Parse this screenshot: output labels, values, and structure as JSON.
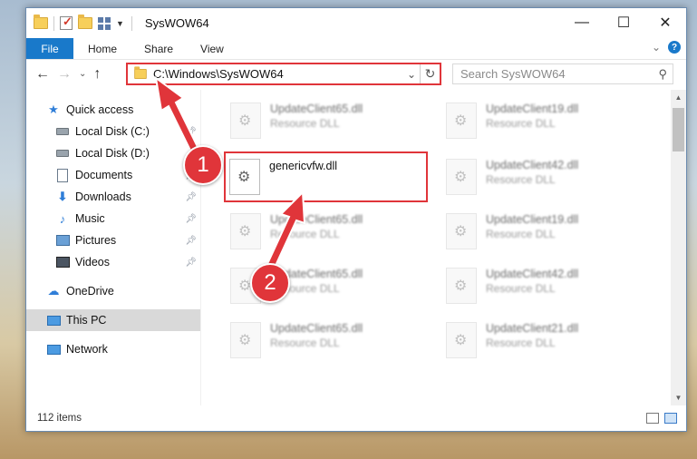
{
  "window": {
    "title": "SysWOW64",
    "controls": {
      "minimize": "—",
      "maximize": "☐",
      "close": "✕"
    }
  },
  "ribbon": {
    "file_tab": "File",
    "tabs": [
      "Home",
      "Share",
      "View"
    ],
    "expand_glyph": "⌄",
    "help_glyph": "?"
  },
  "navigation": {
    "back": "←",
    "forward": "→",
    "recent": "⌄",
    "up": "↑"
  },
  "address": {
    "path": "C:\\Windows\\SysWOW64",
    "dropdown": "⌄",
    "refresh": "↻"
  },
  "search": {
    "placeholder": "Search SysWOW64",
    "icon": "search-icon"
  },
  "sidebar": {
    "items": [
      {
        "label": "Quick access",
        "icon": "star-icon",
        "pinned": false
      },
      {
        "label": "Local Disk (C:)",
        "icon": "drive-icon",
        "pinned": true
      },
      {
        "label": "Local Disk (D:)",
        "icon": "drive-icon",
        "pinned": false
      },
      {
        "label": "Documents",
        "icon": "documents-icon",
        "pinned": true
      },
      {
        "label": "Downloads",
        "icon": "download-icon",
        "pinned": true
      },
      {
        "label": "Music",
        "icon": "music-icon",
        "pinned": true
      },
      {
        "label": "Pictures",
        "icon": "pictures-icon",
        "pinned": true
      },
      {
        "label": "Videos",
        "icon": "videos-icon",
        "pinned": true
      },
      {
        "label": "OneDrive",
        "icon": "cloud-icon",
        "pinned": false
      },
      {
        "label": "This PC",
        "icon": "computer-icon",
        "pinned": false,
        "selected": true
      },
      {
        "label": "Network",
        "icon": "network-icon",
        "pinned": false
      }
    ]
  },
  "files": {
    "left_column": [
      {
        "name": "UpdateClient65.dll",
        "type": "Resource DLL"
      },
      {
        "name": "genericvfw.dll",
        "type": "",
        "highlighted": true
      },
      {
        "name": "UpdateClient65.dll",
        "type": "Resource DLL"
      },
      {
        "name": "UpdateClient65.dll",
        "type": "Resource DLL"
      },
      {
        "name": "UpdateClient65.dll",
        "type": "Resource DLL"
      }
    ],
    "right_column": [
      {
        "name": "UpdateClient19.dll",
        "type": "Resource DLL"
      },
      {
        "name": "UpdateClient42.dll",
        "type": "Resource DLL"
      },
      {
        "name": "UpdateClient19.dll",
        "type": "Resource DLL"
      },
      {
        "name": "UpdateClient42.dll",
        "type": "Resource DLL"
      },
      {
        "name": "UpdateClient21.dll",
        "type": "Resource DLL"
      }
    ]
  },
  "status": {
    "item_count": "112 items"
  },
  "annotations": {
    "badge_1": "1",
    "badge_2": "2",
    "color": "#e0353a"
  }
}
